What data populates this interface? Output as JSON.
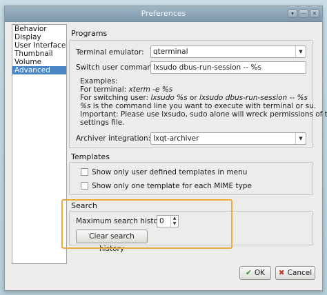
{
  "window": {
    "title": "Preferences"
  },
  "titlebar_buttons": [
    "▾",
    "—",
    "✕"
  ],
  "sidebar": {
    "items": [
      {
        "label": "Behavior",
        "selected": false
      },
      {
        "label": "Display",
        "selected": false
      },
      {
        "label": "User Interface",
        "selected": false
      },
      {
        "label": "Thumbnail",
        "selected": false
      },
      {
        "label": "Volume",
        "selected": false
      },
      {
        "label": "Advanced",
        "selected": true
      }
    ]
  },
  "programs": {
    "heading": "Programs",
    "terminal_label": "Terminal emulator:",
    "terminal_value": "qterminal",
    "switch_user_label": "Switch user command:",
    "switch_user_value": "lxsudo dbus-run-session -- %s",
    "examples_heading": "Examples:",
    "example_terminal_prefix": "For terminal: ",
    "example_terminal_value": "xterm -e %s",
    "example_switch_prefix": "For switching user: ",
    "example_switch_value1": "lxsudo %s",
    "example_switch_or": " or ",
    "example_switch_value2": "lxsudo dbus-run-session -- %s",
    "example_cmd_var": "%s",
    "example_cmd_desc": " is the command line you want to execute with terminal or su.",
    "important_line1": "Important: Please use lxsudo, sudo alone will wreck permissions of the",
    "important_line2": "settings file.",
    "archiver_label": "Archiver integration:",
    "archiver_value": "lxqt-archiver"
  },
  "templates": {
    "heading": "Templates",
    "option_user_defined": "Show only user defined templates in menu",
    "option_one_per_mime": "Show only one template for each MIME type",
    "option_user_defined_checked": false,
    "option_one_per_mime_checked": false
  },
  "search": {
    "heading": "Search",
    "max_history_label": "Maximum search history:",
    "max_history_value": "0",
    "clear_button": "Clear search history"
  },
  "footer": {
    "ok": "OK",
    "cancel": "Cancel"
  },
  "colors": {
    "selection": "#4a86c5",
    "highlight_box": "#f3a83b",
    "titlebar": "#8ea6b8"
  }
}
